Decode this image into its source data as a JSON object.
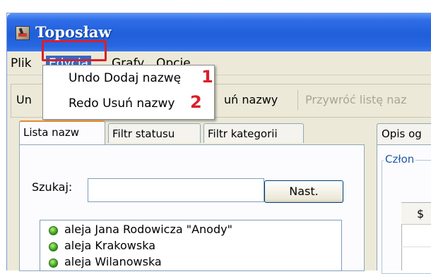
{
  "window": {
    "title": "Toposław"
  },
  "menubar": {
    "items": [
      "Plik",
      "Edycja",
      "Grafy",
      "Opcje"
    ]
  },
  "toolbar": {
    "items": [
      "Un",
      "uń nazwy",
      "Przywróć listę naz"
    ]
  },
  "dropdown": {
    "items": [
      {
        "label": "Undo Dodaj nazwę",
        "number": "1"
      },
      {
        "label": "Redo Usuń nazwy",
        "number": "2"
      }
    ]
  },
  "tabs": [
    "Lista nazw",
    "Filtr statusu",
    "Filtr kategorii"
  ],
  "search": {
    "label": "Szukaj:",
    "value": "",
    "button": "Nast."
  },
  "names_list": [
    "aleja Jana Rodowicza \"Anody\"",
    "aleja Krakowska",
    "aleja Wilanowska"
  ],
  "right_panel": {
    "tab": "Opis og",
    "group_title": "Człon",
    "table_header": "$"
  },
  "colors": {
    "titlebar": "#2766e1",
    "menu_selected": "#316ac5",
    "annotation_red": "#d9202a",
    "tab_accent": "#e68b2c",
    "status_dot": "#3aa01c"
  }
}
